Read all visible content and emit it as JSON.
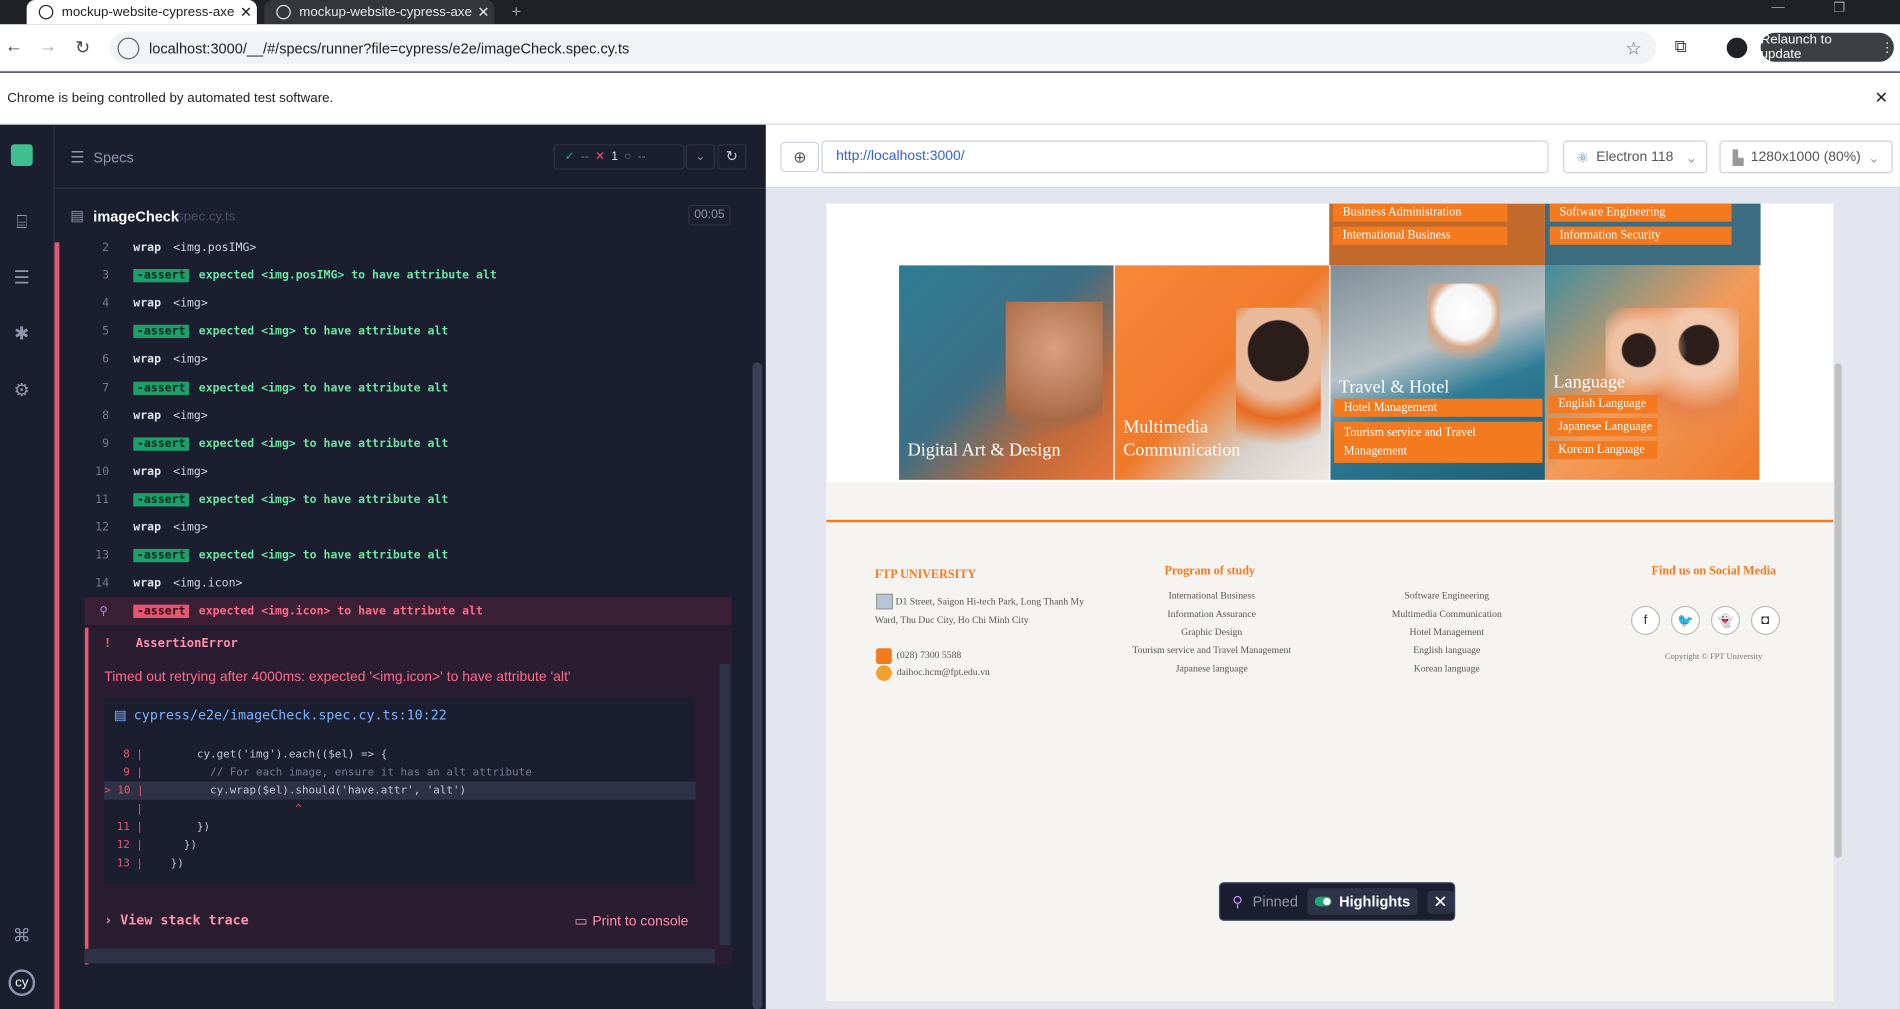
{
  "browser": {
    "tabs": [
      {
        "title": "mockup-website-cypress-axe-in"
      },
      {
        "title": "mockup-website-cypress-axe-in"
      }
    ],
    "url": "localhost:3000/__/#/specs/runner?file=cypress/e2e/imageCheck.spec.cy.ts",
    "relaunch_label": "Relaunch to update",
    "infobar_text": "Chrome is being controlled by automated test software."
  },
  "reporter": {
    "specs_label": "Specs",
    "passed": "--",
    "failed": "1",
    "pending": "--",
    "spec_name": "imageCheck",
    "spec_ext": ".spec.cy.ts",
    "duration": "00:05",
    "commands": [
      {
        "n": "2",
        "kind": "wrap",
        "label": "wrap",
        "text": "<img.posIMG>"
      },
      {
        "n": "3",
        "kind": "assert",
        "label": "-assert",
        "text": "expected <img.posIMG> to have attribute alt"
      },
      {
        "n": "4",
        "kind": "wrap",
        "label": "wrap",
        "text": "<img>"
      },
      {
        "n": "5",
        "kind": "assert",
        "label": "-assert",
        "text": "expected <img> to have attribute alt"
      },
      {
        "n": "6",
        "kind": "wrap",
        "label": "wrap",
        "text": "<img>"
      },
      {
        "n": "7",
        "kind": "assert",
        "label": "-assert",
        "text": "expected <img> to have attribute alt"
      },
      {
        "n": "8",
        "kind": "wrap",
        "label": "wrap",
        "text": "<img>"
      },
      {
        "n": "9",
        "kind": "assert",
        "label": "-assert",
        "text": "expected <img> to have attribute alt"
      },
      {
        "n": "10",
        "kind": "wrap",
        "label": "wrap",
        "text": "<img>"
      },
      {
        "n": "11",
        "kind": "assert",
        "label": "-assert",
        "text": "expected <img> to have attribute alt"
      },
      {
        "n": "12",
        "kind": "wrap",
        "label": "wrap",
        "text": "<img>"
      },
      {
        "n": "13",
        "kind": "assert",
        "label": "-assert",
        "text": "expected <img> to have attribute alt"
      },
      {
        "n": "14",
        "kind": "wrap",
        "label": "wrap",
        "text": "<img.icon>"
      },
      {
        "n": "",
        "kind": "fail",
        "label": "-assert",
        "text": "expected <img.icon> to have attribute alt"
      }
    ],
    "error": {
      "type": "AssertionError",
      "message": "Timed out retrying after 4000ms: expected '<img.icon>' to have attribute 'alt'",
      "file_link": "cypress/e2e/imageCheck.spec.cy.ts:10:22",
      "code_lines": [
        {
          "n": "8 |",
          "text": "      cy.get('img').each(($el) => {"
        },
        {
          "n": "9 |",
          "text": "        // For each image, ensure it has an alt attribute"
        },
        {
          "n": "> 10 |",
          "text": "        cy.wrap($el).should('have.attr', 'alt')"
        },
        {
          "n": "|",
          "text": "                     ^"
        },
        {
          "n": "11 |",
          "text": "      })"
        },
        {
          "n": "12 |",
          "text": "    })"
        },
        {
          "n": "13 |",
          "text": "  })"
        }
      ],
      "stack_trace_label": "View stack trace",
      "print_label": "Print to console"
    }
  },
  "aut": {
    "url": "http://localhost:3000/",
    "browser": "Electron 118",
    "viewport": "1280x1000 (80%)",
    "top_left_items": [
      "Business Administration",
      "International Business"
    ],
    "top_right_items": [
      "Software Engineering",
      "Information Security"
    ],
    "cards": [
      {
        "title": "Digital Art & Design",
        "items": []
      },
      {
        "title": "Multimedia Communication",
        "items": []
      },
      {
        "title": "Travel & Hotel",
        "items": [
          "Hotel Management",
          "Tourism service and Travel Management"
        ]
      },
      {
        "title": "Language",
        "items": [
          "English Language",
          "Japanese Language",
          "Korean Language"
        ]
      }
    ],
    "footer": {
      "university": "FTP UNIVERSITY",
      "address": "D1 Street, Saigon Hi-tech Park, Long Thanh My Ward, Thu Duc City, Ho Chi Minh City",
      "phone": "(028) 7300 5588",
      "email": "daihoc.hcm@fpt.edu.vn",
      "program_heading": "Program of study",
      "programs_col1": [
        "International Business",
        "Information Assurance",
        "Graphic Design",
        "Tourism service and Travel Management",
        "Japanese language"
      ],
      "programs_col2": [
        "Software Engineering",
        "Multimedia Communication",
        "Hotel Management",
        "English language",
        "Korean language"
      ],
      "social_heading": "Find us on Social Media",
      "copyright": "Copyright © FPT University"
    }
  },
  "pinned": {
    "label": "Pinned",
    "highlights": "Highlights"
  }
}
